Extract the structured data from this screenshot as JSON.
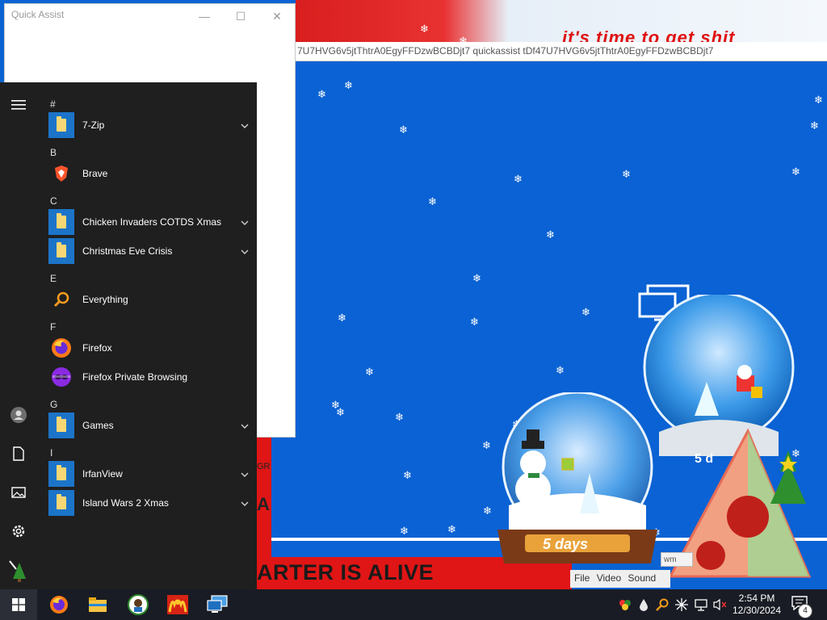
{
  "desktop": {
    "banner_text": "it's time to get shit",
    "address_text": "7U7HVG6v5jtThtrA0EgyFFDzwBCBDjt7 quickassist tDf47U7HVG6v5jtThtrA0EgyFFDzwBCBDjt7",
    "alive_text": "ARTER IS ALIVE",
    "side_a": "A",
    "side_gr": "GR",
    "wm_label": "wm",
    "player_menu": {
      "file": "File",
      "video": "Video",
      "sound": "Sound"
    },
    "globe_small_text": "5 days",
    "globe_large_text": "5 d"
  },
  "quick_assist": {
    "title": "Quick Assist",
    "minimize": "—",
    "maximize": "☐",
    "close": "✕"
  },
  "start_menu": {
    "sections": [
      {
        "letter": "#",
        "apps": [
          {
            "label": "7-Zip",
            "icon": "folder-icon",
            "expandable": true
          }
        ]
      },
      {
        "letter": "B",
        "apps": [
          {
            "label": "Brave",
            "icon": "brave-icon",
            "expandable": false
          }
        ]
      },
      {
        "letter": "C",
        "apps": [
          {
            "label": "Chicken Invaders COTDS Xmas",
            "icon": "folder-icon",
            "expandable": true
          },
          {
            "label": "Christmas Eve Crisis",
            "icon": "folder-icon",
            "expandable": true
          }
        ]
      },
      {
        "letter": "E",
        "apps": [
          {
            "label": "Everything",
            "icon": "search-icon",
            "expandable": false
          }
        ]
      },
      {
        "letter": "F",
        "apps": [
          {
            "label": "Firefox",
            "icon": "firefox-icon",
            "expandable": false
          },
          {
            "label": "Firefox Private Browsing",
            "icon": "private-browsing-icon",
            "expandable": false
          }
        ]
      },
      {
        "letter": "G",
        "apps": [
          {
            "label": "Games",
            "icon": "folder-icon",
            "expandable": true
          }
        ]
      },
      {
        "letter": "I",
        "apps": [
          {
            "label": "IrfanView",
            "icon": "folder-icon",
            "expandable": true
          },
          {
            "label": "Island Wars 2 Xmas",
            "icon": "folder-icon",
            "expandable": true
          }
        ]
      }
    ],
    "rail_icons": [
      "hamburger-icon",
      "user-icon",
      "documents-icon",
      "pictures-icon",
      "settings-icon",
      "tree-icon"
    ]
  },
  "taskbar": {
    "apps": [
      "firefox-icon",
      "file-explorer-icon",
      "game-icon",
      "mcdonalds-icon",
      "remote-desktop-icon"
    ],
    "tray_icons": [
      "app-tray-icon",
      "drop-icon",
      "search-tray-icon",
      "network-activity-icon",
      "network-icon",
      "volume-muted-icon"
    ],
    "time": "2:54 PM",
    "date": "12/30/2024",
    "notification_count": "4"
  },
  "colors": {
    "taskbar": "#191c24",
    "start_menu": "#1f1f1f",
    "tile_blue": "#1c74c9",
    "desktop_blue": "#0a62d4"
  }
}
